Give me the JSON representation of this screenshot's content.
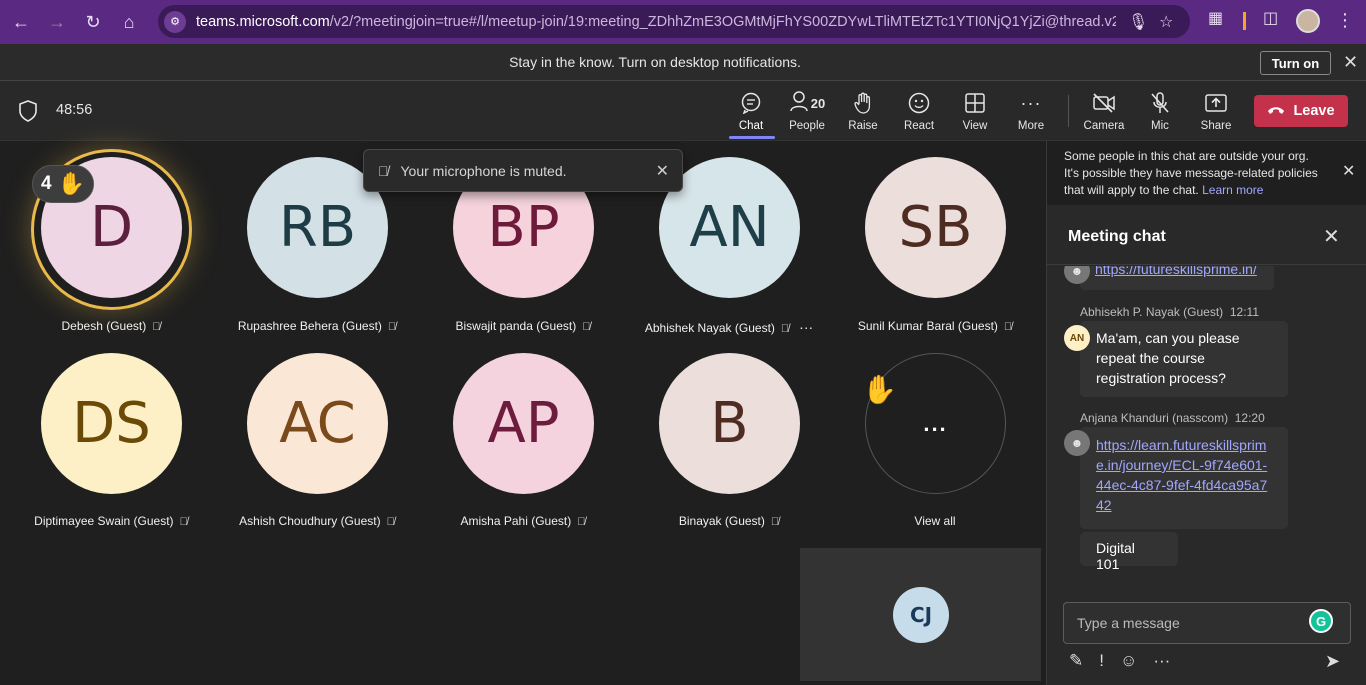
{
  "browser": {
    "url_host": "teams.microsoft.com",
    "url_rest": "/v2/?meetingjoin=true#/l/meetup-join/19:meeting_ZDhhZmE3OGMtMjFhYS00ZDYwLTliMTEtZTc1YTI0NjQ1YjZi@thread.v2/0?co..."
  },
  "notification": {
    "message": "Stay in the know. Turn on desktop notifications.",
    "button_label": "Turn on"
  },
  "toolbar": {
    "timer": "48:56",
    "chat": "Chat",
    "people": "People",
    "people_count": "20",
    "raise": "Raise",
    "react": "React",
    "view": "View",
    "more": "More",
    "camera": "Camera",
    "mic": "Mic",
    "share": "Share",
    "leave": "Leave"
  },
  "toast": {
    "text": "Your microphone is muted."
  },
  "speaker_badge": {
    "count": "4"
  },
  "participants": [
    {
      "initials": "D",
      "name": "Debesh (Guest)",
      "bg": "#eed6e4",
      "fg": "#5c1f3e"
    },
    {
      "initials": "RB",
      "name": "Rupashree Behera (Guest)",
      "bg": "#d3e0e6",
      "fg": "#1e3c45"
    },
    {
      "initials": "BP",
      "name": "Biswajit panda (Guest)",
      "bg": "#f5d2dc",
      "fg": "#6e1a3a"
    },
    {
      "initials": "AN",
      "name": "Abhishek Nayak (Guest)",
      "bg": "#d6e5ea",
      "fg": "#1f3f48"
    },
    {
      "initials": "SB",
      "name": "Sunil Kumar Baral (Guest)",
      "bg": "#ecdfdb",
      "fg": "#4e2c22"
    },
    {
      "initials": "DS",
      "name": "Diptimayee Swain (Guest)",
      "bg": "#fdf0c6",
      "fg": "#6b4a07"
    },
    {
      "initials": "AC",
      "name": "Ashish Choudhury (Guest)",
      "bg": "#fbe7d6",
      "fg": "#7a4a1b"
    },
    {
      "initials": "AP",
      "name": "Amisha Pahi (Guest)",
      "bg": "#f4d3df",
      "fg": "#6d1c3e"
    },
    {
      "initials": "B",
      "name": "Binayak (Guest)",
      "bg": "#ecdfdb",
      "fg": "#4e2c22"
    }
  ],
  "view_all": {
    "label": "View all",
    "dots": "..."
  },
  "self": {
    "initials": "CJ"
  },
  "chat": {
    "org_note": "Some people in this chat are outside your org. It's possible they have message-related policies that will apply to the chat.",
    "learn_more": "Learn more",
    "title": "Meeting chat",
    "partial_link": "https://futureskillsprime.in/",
    "msg1_sender": "Abhisekh P. Nayak (Guest)",
    "msg1_time": "12:11",
    "msg1_avatar": "AN",
    "msg1_text": "Ma'am, can you please repeat the course registration process?",
    "msg2_sender": "Anjana Khanduri (nasscom)",
    "msg2_time": "12:20",
    "msg2_link": "https://learn.futureskillsprime.in/journey/ECL-9f74e601-44ec-4c87-9fef-4fd4ca95a742",
    "msg3_text": "Digital 101",
    "compose_placeholder": "Type a message"
  }
}
